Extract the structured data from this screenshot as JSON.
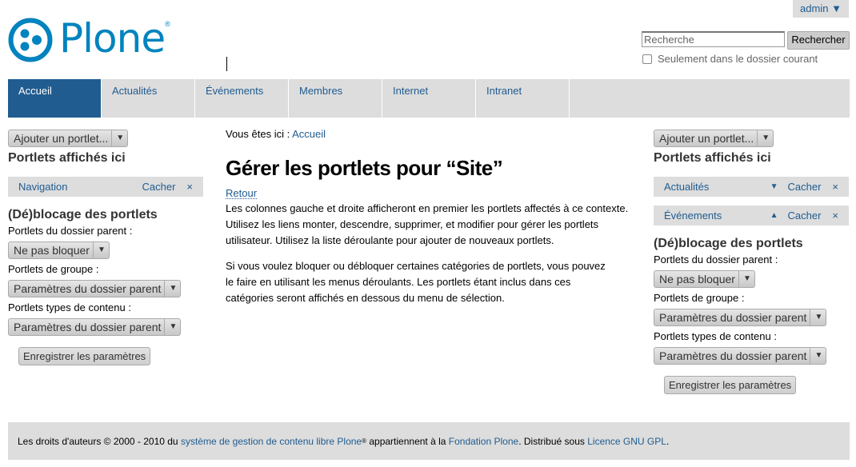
{
  "user_menu": {
    "label": "admin ▼"
  },
  "logo": {
    "text": "Plone",
    "reg": "®"
  },
  "search": {
    "placeholder": "Recherche",
    "button": "Rechercher",
    "option": "Seulement dans le dossier courant"
  },
  "nav": {
    "tabs": [
      "Accueil",
      "Actualités",
      "Événements",
      "Membres",
      "Internet",
      "Intranet"
    ],
    "active": "Accueil"
  },
  "left": {
    "add_portlet": "Ajouter un portlet...",
    "shown_title": "Portlets affichés ici",
    "portlets": [
      {
        "name": "Navigation",
        "hide": "Cacher",
        "remove": "×"
      }
    ],
    "block_title": "(Dé)blocage des portlets",
    "parent_label": "Portlets du dossier parent :",
    "parent_value": "Ne pas bloquer",
    "group_label": "Portlets de groupe :",
    "group_value": "Paramètres du dossier parent",
    "content_label": "Portlets types de contenu :",
    "content_value": "Paramètres du dossier parent",
    "save": "Enregistrer les paramètres"
  },
  "right": {
    "add_portlet": "Ajouter un portlet...",
    "shown_title": "Portlets affichés ici",
    "portlets": [
      {
        "name": "Actualités",
        "move": "▼",
        "hide": "Cacher",
        "remove": "×"
      },
      {
        "name": "Événements",
        "move": "▲",
        "hide": "Cacher",
        "remove": "×"
      }
    ],
    "block_title": "(Dé)blocage des portlets",
    "parent_label": "Portlets du dossier parent :",
    "parent_value": "Ne pas bloquer",
    "group_label": "Portlets de groupe :",
    "group_value": "Paramètres du dossier parent",
    "content_label": "Portlets types de contenu :",
    "content_value": "Paramètres du dossier parent",
    "save": "Enregistrer les paramètres"
  },
  "main": {
    "breadcrumb_label": "Vous êtes ici :",
    "breadcrumb_link": "Accueil",
    "title": "Gérer les portlets pour “Site”",
    "back": "Retour",
    "para1": "Les colonnes gauche et droite afficheront en premier les portlets affectés à ce contexte. Utilisez les liens monter, descendre, supprimer, et modifier pour gérer les portlets utilisateur. Utilisez la liste déroulante pour ajouter de nouveaux portlets.",
    "para2": "Si vous voulez bloquer ou débloquer certaines catégories de portlets, vous pouvez le faire en utilisant les menus déroulants. Les portlets étant inclus dans ces catégories seront affichés en dessous du menu de sélection."
  },
  "footer": {
    "t1": "Les droits d'auteurs © 2000 - 2010 du ",
    "l1": "système de gestion de contenu libre Plone",
    "reg": "®",
    "t2": " appartiennent à la ",
    "l2": "Fondation Plone",
    "t3": ". Distribué sous ",
    "l3": "Licence GNU GPL",
    "t4": "."
  },
  "colors": {
    "accent": "#205c90",
    "logo": "#0083be",
    "bar": "#dddddd"
  }
}
